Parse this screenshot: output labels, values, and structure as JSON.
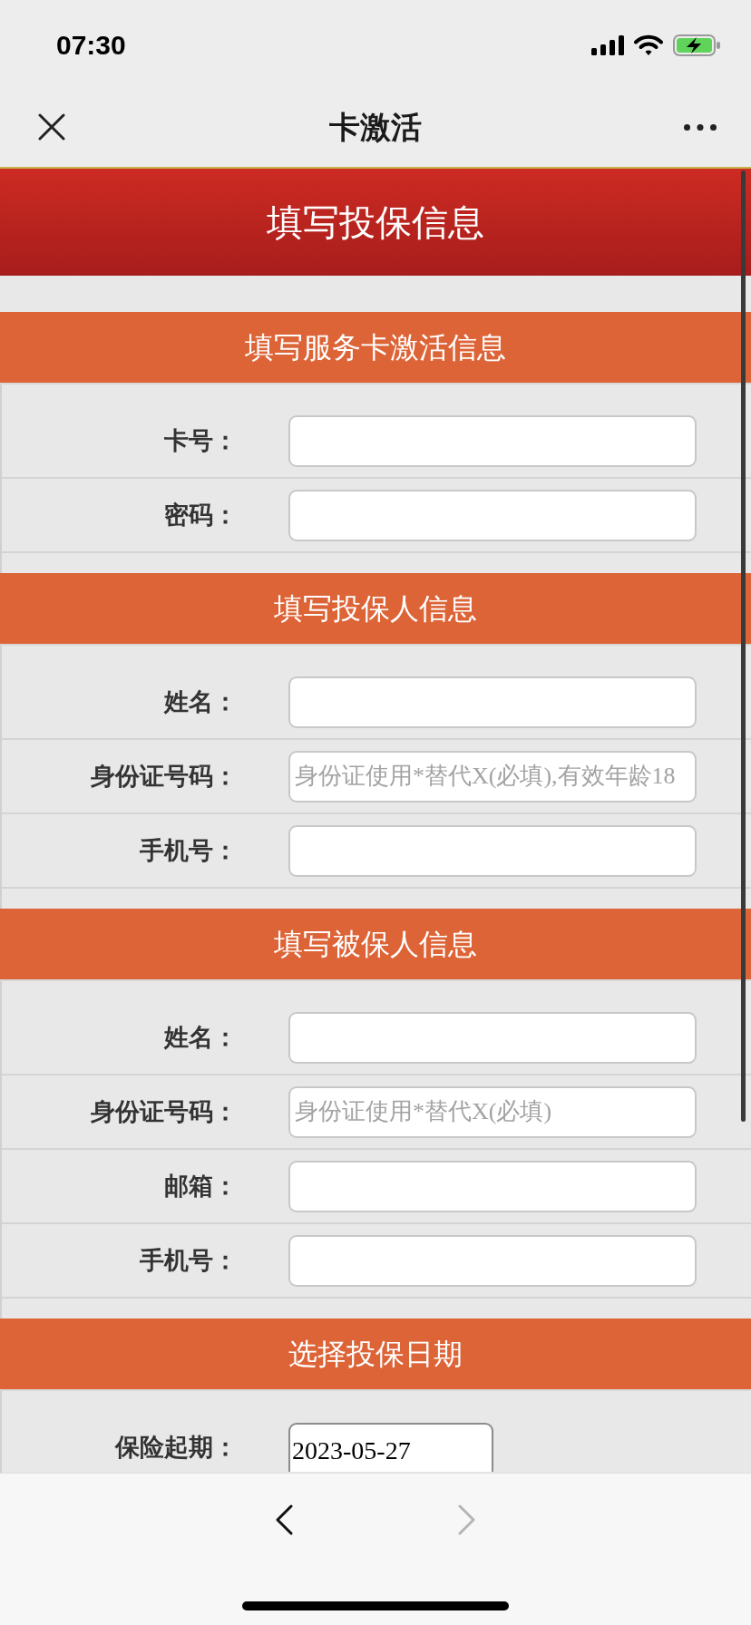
{
  "status_bar": {
    "time": "07:30"
  },
  "nav_bar": {
    "title": "卡激活"
  },
  "page_header": {
    "title": "填写投保信息"
  },
  "sections": [
    {
      "title": "填写服务卡激活信息",
      "fields": [
        {
          "label": "卡号：",
          "kind": "text"
        },
        {
          "label": "密码：",
          "kind": "text"
        }
      ]
    },
    {
      "title": "填写投保人信息",
      "fields": [
        {
          "label": "姓名：",
          "kind": "text"
        },
        {
          "label": "身份证号码：",
          "kind": "text",
          "placeholder": "身份证使用*替代X(必填),有效年龄18"
        },
        {
          "label": "手机号：",
          "kind": "text"
        }
      ]
    },
    {
      "title": "填写被保人信息",
      "fields": [
        {
          "label": "姓名：",
          "kind": "text"
        },
        {
          "label": "身份证号码：",
          "kind": "text",
          "placeholder": "身份证使用*替代X(必填)"
        },
        {
          "label": "邮箱：",
          "kind": "text"
        },
        {
          "label": "手机号：",
          "kind": "text"
        }
      ]
    },
    {
      "title": "选择投保日期",
      "fields": [
        {
          "label": "保险起期：",
          "kind": "date",
          "value": "2023-05-27"
        }
      ]
    }
  ],
  "toolbar": {
    "buttons": [
      {
        "kind": "back",
        "disabled": false
      },
      {
        "kind": "forward",
        "disabled": true
      }
    ]
  }
}
